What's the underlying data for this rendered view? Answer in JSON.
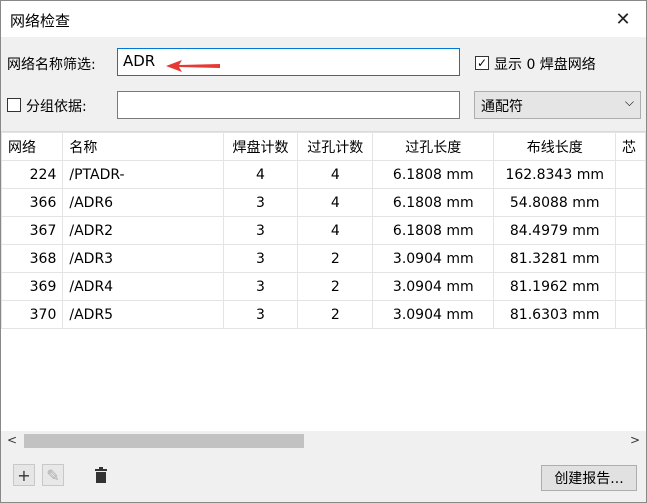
{
  "window": {
    "title": "网络检查"
  },
  "filter": {
    "label": "网络名称筛选:",
    "value": "ADR",
    "show_zero_pad_label": "显示 0 焊盘网络",
    "show_zero_pad_checked": "✓"
  },
  "group": {
    "label": "分组依据:",
    "value": "",
    "mode": "通配符"
  },
  "table": {
    "headers": [
      "网络",
      "名称",
      "焊盘计数",
      "过孔计数",
      "过孔长度",
      "布线长度",
      "芯"
    ],
    "rows": [
      [
        "224",
        "/PTADR-",
        "4",
        "4",
        "6.1808 mm",
        "162.8343 mm",
        ""
      ],
      [
        "366",
        "/ADR6",
        "3",
        "4",
        "6.1808 mm",
        "54.8088 mm",
        ""
      ],
      [
        "367",
        "/ADR2",
        "3",
        "4",
        "6.1808 mm",
        "84.4979 mm",
        ""
      ],
      [
        "368",
        "/ADR3",
        "3",
        "2",
        "3.0904 mm",
        "81.3281 mm",
        ""
      ],
      [
        "369",
        "/ADR4",
        "3",
        "2",
        "3.0904 mm",
        "81.1962 mm",
        ""
      ],
      [
        "370",
        "/ADR5",
        "3",
        "2",
        "3.0904 mm",
        "81.6303 mm",
        ""
      ]
    ]
  },
  "footer": {
    "report_button_label": "创建报告..."
  },
  "colors": {
    "accent": "#0078d7",
    "arrow": "#e53935"
  }
}
